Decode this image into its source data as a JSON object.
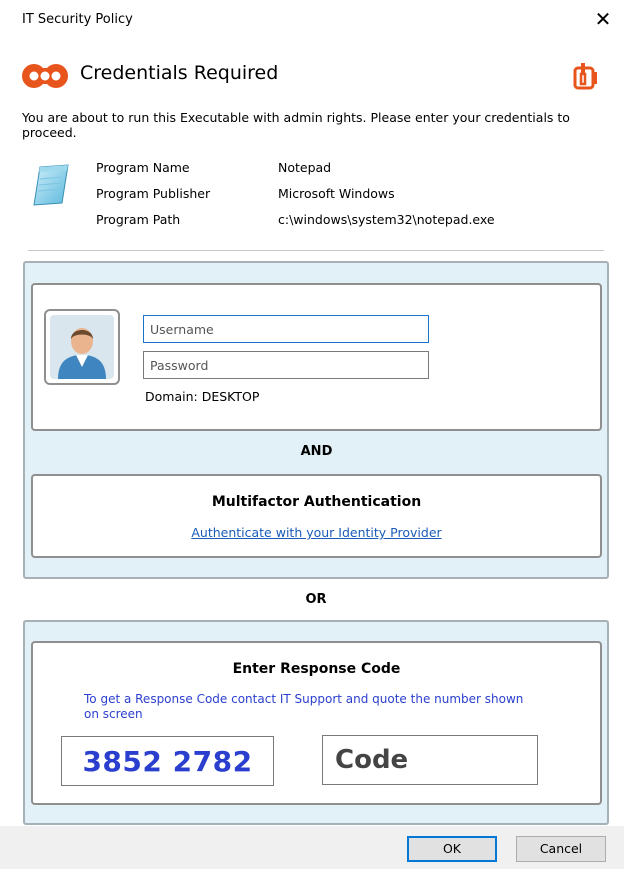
{
  "window": {
    "title": "IT Security Policy",
    "close_glyph": "✕"
  },
  "header": {
    "title": "Credentials Required",
    "icon": "key-shield-icon",
    "brand_icon": "brand-logo-icon",
    "accent": "#e8551c"
  },
  "description": "You are about to run this Executable with admin rights. Please enter your credentials to proceed.",
  "program": {
    "icon": "notepad-icon",
    "rows": [
      {
        "label": "Program Name",
        "value": "Notepad"
      },
      {
        "label": "Program Publisher",
        "value": "Microsoft Windows"
      },
      {
        "label": "Program Path",
        "value": "c:\\windows\\system32\\notepad.exe"
      }
    ]
  },
  "login": {
    "avatar_icon": "user-avatar-icon",
    "username_placeholder": "Username",
    "password_placeholder": "Password",
    "username_value": "",
    "password_value": "",
    "domain": "Domain: DESKTOP"
  },
  "and_label": "AND",
  "mfa": {
    "title": "Multifactor Authentication",
    "link": "Authenticate with your Identity Provider"
  },
  "or_label": "OR",
  "response": {
    "title": "Enter Response Code",
    "instructions": "To get a Response Code contact IT Support and quote the number shown on screen",
    "challenge": "3852 2782",
    "code_placeholder": "Code",
    "code_value": ""
  },
  "buttons": {
    "ok": "OK",
    "cancel": "Cancel"
  },
  "colors": {
    "panel_bg": "#e1f1f7",
    "link": "#1a5cb8",
    "challenge": "#2b3fcf"
  }
}
